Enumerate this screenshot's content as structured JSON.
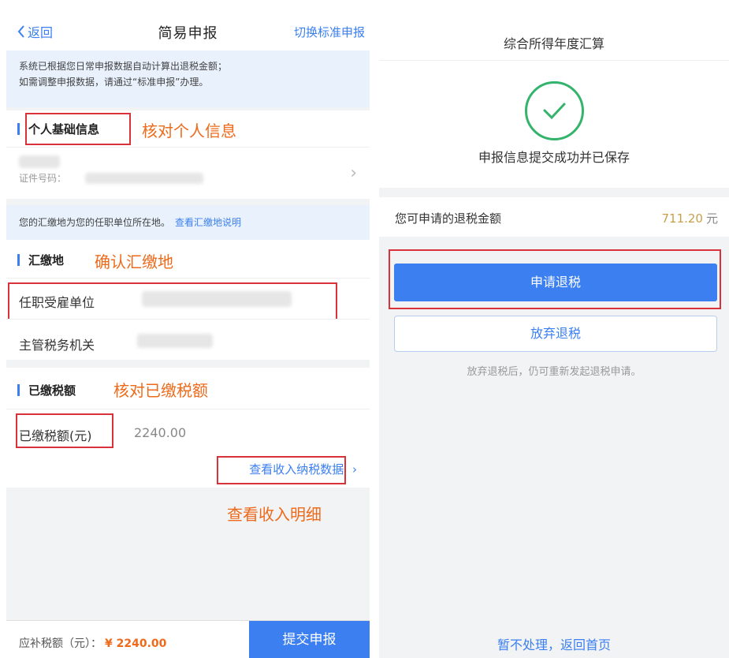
{
  "left": {
    "nav": {
      "back": "返回",
      "title": "简易申报",
      "switch": "切换标准申报"
    },
    "notice": {
      "line1": "系统已根据您日常申报数据自动计算出退税金额；",
      "line2": "如需调整申报数据，请通过“标准申报”办理。"
    },
    "personal": {
      "title": "个人基础信息",
      "annotation": "核对个人信息",
      "cert_label": "证件号码："
    },
    "huijiao_note": {
      "text": "您的汇缴地为您的任职单位所在地。",
      "link": "查看汇缴地说明"
    },
    "huijiao": {
      "title": "汇缴地",
      "annotation": "确认汇缴地",
      "employer_label": "任职受雇单位",
      "tax_office_label": "主管税务机关"
    },
    "paid": {
      "title": "已缴税额",
      "annotation": "核对已缴税额",
      "label": "已缴税额(元)",
      "value": "2240.00"
    },
    "income_link": "查看收入纳税数据",
    "income_annotation": "查看收入明细",
    "bottom": {
      "label": "应补税额（元）：",
      "amount": "¥ 2240.00",
      "submit": "提交申报"
    }
  },
  "right": {
    "title": "综合所得年度汇算",
    "success": "申报信息提交成功并已保存",
    "refund_label": "您可申请的退税金额",
    "refund_amount": "711.20",
    "refund_unit": "元",
    "apply_button": "申请退税",
    "abandon_button": "放弃退税",
    "hint": "放弃退税后，仍可重新发起退税申请。",
    "home_link": "暂不处理，返回首页"
  },
  "colors": {
    "primary": "#3b7ff0",
    "annotation": "#ee6a1a",
    "success": "#34b36c",
    "highlight_box": "#d9323a",
    "refund": "#c9a04a"
  }
}
